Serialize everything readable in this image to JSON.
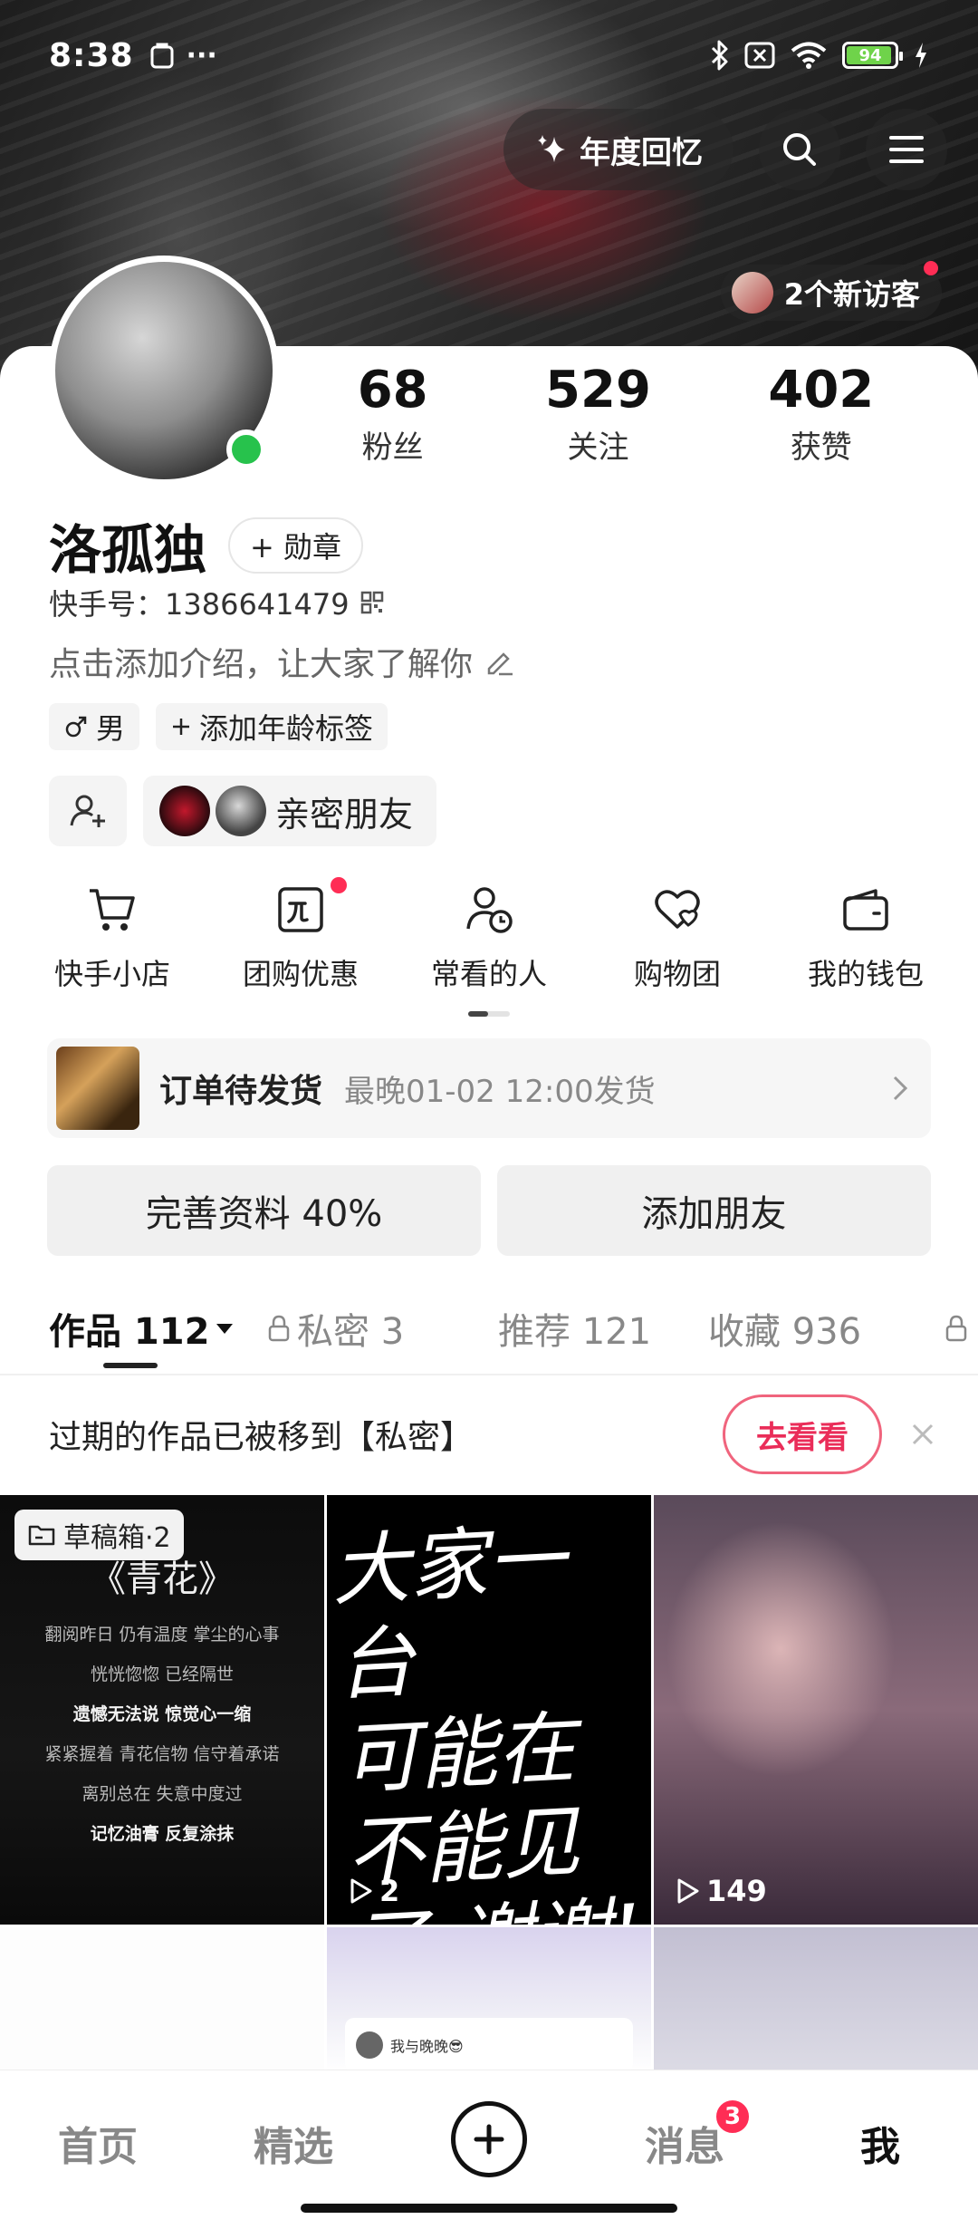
{
  "status_bar": {
    "time": "8:38",
    "battery_level": "94",
    "battery_fraction": 0.94,
    "more_label": "···"
  },
  "header": {
    "year_review_label": "年度回忆",
    "visitors_label": "2个新访客"
  },
  "profile": {
    "name": "洛孤独",
    "badge_button_label": "+ 勋章",
    "kuaishou_id_label": "快手号：1386641479",
    "bio_placeholder": "点击添加介绍，让大家了解你",
    "gender_tag": "男",
    "age_tag": "添加年龄标签",
    "close_friends_label": "亲密朋友",
    "online": true
  },
  "stats": [
    {
      "value": "68",
      "label": "粉丝"
    },
    {
      "value": "529",
      "label": "关注"
    },
    {
      "value": "402",
      "label": "获赞"
    }
  ],
  "quick_actions": [
    {
      "label": "快手小店",
      "icon": "cart-icon"
    },
    {
      "label": "团购优惠",
      "icon": "coupon-icon"
    },
    {
      "label": "常看的人",
      "icon": "person-clock-icon"
    },
    {
      "label": "购物团",
      "icon": "heart-group-icon"
    },
    {
      "label": "我的钱包",
      "icon": "wallet-icon"
    }
  ],
  "order": {
    "title": "订单待发货",
    "subtitle": "最晚01-02 12:00发货"
  },
  "action_buttons": {
    "complete_profile": "完善资料 40%",
    "add_friends": "添加朋友"
  },
  "tabs": [
    {
      "label": "作品 112",
      "active": true
    },
    {
      "label": "私密 3",
      "locked": true
    },
    {
      "label": "推荐 121"
    },
    {
      "label": "收藏 936"
    }
  ],
  "notice": {
    "text": "过期的作品已被移到【私密】",
    "button_label": "去看看"
  },
  "grid": {
    "draft_label": "草稿箱·2",
    "poem_title": "《青花》",
    "poem_lines": [
      "翻阅昨日 仍有温度 掌尘的心事",
      "恍恍惚惚 已经隔世",
      "遗憾无法说 惊觉心一缩",
      "紧紧握着 青花信物 信守着承诺",
      "离别总在 失意中度过",
      "记忆油膏 反复涂抹"
    ],
    "handwriting_lines": [
      "大家一台",
      "可能在",
      "不能见",
      "了,谢谢!"
    ],
    "video2_views": "2",
    "video3_views": "149",
    "mini_card_text": "我与晚晚😎"
  },
  "bottom_nav": {
    "home": "首页",
    "featured": "精选",
    "messages": "消息",
    "messages_badge": "3",
    "me": "我"
  }
}
